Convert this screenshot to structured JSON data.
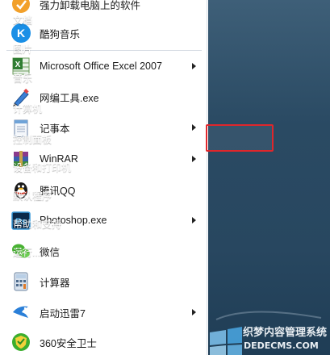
{
  "programs": [
    {
      "label": "强力卸载电脑上的软件",
      "icon": "uninstall-icon",
      "submenu": false
    },
    {
      "label": "酷狗音乐",
      "icon": "kugou-music-icon",
      "submenu": false
    },
    {
      "label": "Microsoft Office Excel 2007",
      "icon": "excel-icon",
      "submenu": true
    },
    {
      "label": "网编工具.exe",
      "icon": "pen-icon",
      "submenu": false
    },
    {
      "label": "记事本",
      "icon": "notepad-icon",
      "submenu": true
    },
    {
      "label": "WinRAR",
      "icon": "winrar-icon",
      "submenu": true
    },
    {
      "label": "腾讯QQ",
      "icon": "qq-penguin-icon",
      "submenu": false
    },
    {
      "label": "Photoshop.exe",
      "icon": "photoshop-icon",
      "submenu": true
    },
    {
      "label": "微信",
      "icon": "wechat-icon",
      "submenu": false
    },
    {
      "label": "计算器",
      "icon": "calculator-icon",
      "submenu": false
    },
    {
      "label": "启动迅雷7",
      "icon": "thunder-bird-icon",
      "submenu": true
    },
    {
      "label": "360安全卫士",
      "icon": "shield-360-icon",
      "submenu": false
    }
  ],
  "places": [
    {
      "label": "文档"
    },
    {
      "label": "图片"
    },
    {
      "label": "音乐"
    },
    {
      "label": "计算机"
    },
    {
      "label": "控制面板",
      "highlighted": true
    },
    {
      "label": "设备和打印机"
    },
    {
      "label": "默认程序"
    },
    {
      "label": "帮助和支持"
    },
    {
      "label": "运行..."
    }
  ],
  "watermark": {
    "line1": "织梦内容管理系统",
    "line2": "DEDECMS.COM"
  },
  "colors": {
    "highlight_border": "#e0262b",
    "right_pane": "#2a4a63"
  }
}
